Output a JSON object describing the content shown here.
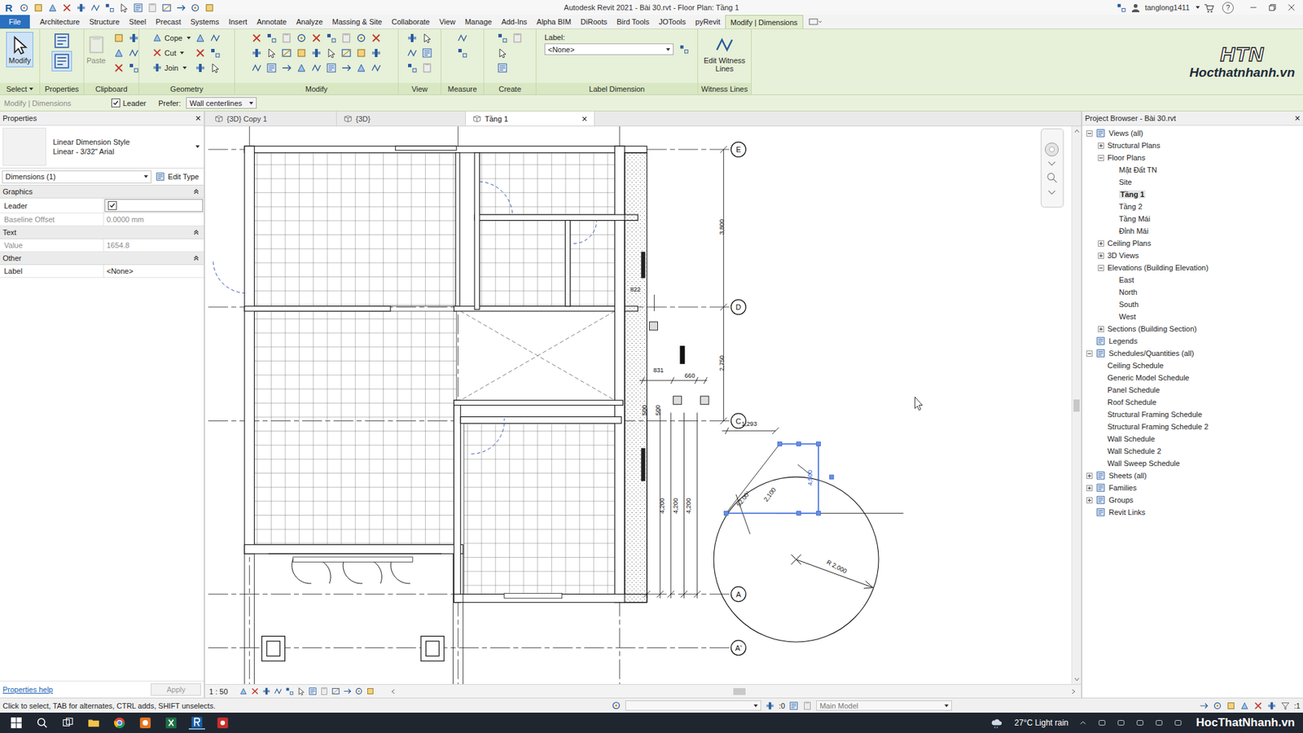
{
  "window": {
    "app_logo": "R",
    "title": "Autodesk Revit 2021 - Bài 30.rvt - Floor Plan: Tầng 1",
    "user": "tanglong1411",
    "help": "?"
  },
  "menu_tabs": [
    {
      "label": "File",
      "selected": false,
      "kind": "file"
    },
    {
      "label": "Architecture",
      "selected": false,
      "kind": "tab"
    },
    {
      "label": "Structure",
      "selected": false,
      "kind": "tab"
    },
    {
      "label": "Steel",
      "selected": false,
      "kind": "tab"
    },
    {
      "label": "Precast",
      "selected": false,
      "kind": "tab"
    },
    {
      "label": "Systems",
      "selected": false,
      "kind": "tab"
    },
    {
      "label": "Insert",
      "selected": false,
      "kind": "tab"
    },
    {
      "label": "Annotate",
      "selected": false,
      "kind": "tab"
    },
    {
      "label": "Analyze",
      "selected": false,
      "kind": "tab"
    },
    {
      "label": "Massing & Site",
      "selected": false,
      "kind": "tab"
    },
    {
      "label": "Collaborate",
      "selected": false,
      "kind": "tab"
    },
    {
      "label": "View",
      "selected": false,
      "kind": "tab"
    },
    {
      "label": "Manage",
      "selected": false,
      "kind": "tab"
    },
    {
      "label": "Add-Ins",
      "selected": false,
      "kind": "tab"
    },
    {
      "label": "Alpha BIM",
      "selected": false,
      "kind": "tab"
    },
    {
      "label": "DiRoots",
      "selected": false,
      "kind": "tab"
    },
    {
      "label": "Bird Tools",
      "selected": false,
      "kind": "tab"
    },
    {
      "label": "JOTools",
      "selected": false,
      "kind": "tab"
    },
    {
      "label": "pyRevit",
      "selected": false,
      "kind": "tab"
    },
    {
      "label": "Modify | Dimensions",
      "selected": true,
      "kind": "tab"
    }
  ],
  "ribbon": {
    "panels": [
      {
        "label": "Select",
        "dropdown": true,
        "large": [
          {
            "label": "Modify",
            "active": true,
            "disabled": false
          }
        ],
        "small": []
      },
      {
        "label": "Properties",
        "dropdown": false,
        "large": [],
        "small": []
      },
      {
        "label": "Clipboard",
        "dropdown": false,
        "large": [
          {
            "label": "Paste",
            "active": false,
            "disabled": true
          }
        ],
        "small": []
      },
      {
        "label": "Geometry",
        "dropdown": false,
        "large": [],
        "small": [
          {
            "label": "Cope"
          },
          {
            "label": "Cut"
          },
          {
            "label": "Join"
          }
        ]
      },
      {
        "label": "Modify",
        "dropdown": false,
        "large": [],
        "small": []
      },
      {
        "label": "View",
        "dropdown": false,
        "large": [],
        "small": []
      },
      {
        "label": "Measure",
        "dropdown": false,
        "large": [],
        "small": []
      },
      {
        "label": "Create",
        "dropdown": false,
        "large": [],
        "small": []
      },
      {
        "label": "Label Dimension",
        "dropdown": false,
        "large": [],
        "small": [],
        "field": {
          "caption": "Label:",
          "value": "<None>"
        }
      },
      {
        "label": "Witness Lines",
        "dropdown": false,
        "large": [
          {
            "label": "Edit Witness Lines",
            "active": false,
            "disabled": false
          }
        ],
        "small": []
      }
    ]
  },
  "logo": {
    "mark": "HTN",
    "site": "Hocthatnhanh.vn"
  },
  "options_bar": {
    "context": "Modify | Dimensions",
    "leader": {
      "label": "Leader",
      "checked": true
    },
    "prefer": {
      "label": "Prefer:",
      "value": "Wall centerlines"
    }
  },
  "properties": {
    "title": "Properties",
    "close": "×",
    "type_family": "Linear Dimension Style",
    "type_name": "Linear - 3/32\" Arial",
    "filter": "Dimensions (1)",
    "edit_type": "Edit Type",
    "groups": [
      {
        "name": "Graphics",
        "expanded": true,
        "rows": [
          {
            "label": "Leader",
            "kind": "checkbox",
            "checked": true,
            "value": "",
            "disabled": false
          },
          {
            "label": "Baseline Offset",
            "kind": "text",
            "checked": false,
            "value": "0.0000 mm",
            "disabled": true
          }
        ]
      },
      {
        "name": "Text",
        "expanded": true,
        "rows": [
          {
            "label": "Value",
            "kind": "text",
            "checked": false,
            "value": "1654.8",
            "disabled": true
          }
        ]
      },
      {
        "name": "Other",
        "expanded": true,
        "rows": [
          {
            "label": "Label",
            "kind": "text",
            "checked": false,
            "value": "<None>",
            "disabled": false
          }
        ]
      }
    ],
    "help": "Properties help",
    "apply": {
      "label": "Apply",
      "disabled": true
    }
  },
  "view_tabs": [
    {
      "label": "{3D} Copy 1",
      "selected": false,
      "closable": false
    },
    {
      "label": "{3D}",
      "selected": false,
      "closable": false
    },
    {
      "label": "Tầng 1",
      "selected": true,
      "closable": true
    }
  ],
  "view_close": "×",
  "drawing": {
    "grids": [
      {
        "label": "E"
      },
      {
        "label": "D"
      },
      {
        "label": "C"
      },
      {
        "label": "A"
      },
      {
        "label": "A'"
      }
    ],
    "dimensions": [
      {
        "text": "3,800",
        "selected": false
      },
      {
        "text": "2,750",
        "selected": false
      },
      {
        "text": "822",
        "selected": false
      },
      {
        "text": "831",
        "selected": false
      },
      {
        "text": "660",
        "selected": false
      },
      {
        "text": "500",
        "selected": false
      },
      {
        "text": "500",
        "selected": false
      },
      {
        "text": "4,200",
        "selected": false
      },
      {
        "text": "4,200",
        "selected": false
      },
      {
        "text": "4,200",
        "selected": false
      },
      {
        "text": "1,293",
        "selected": false
      },
      {
        "text": "2,100",
        "selected": false
      },
      {
        "text": "52.00°",
        "selected": false
      },
      {
        "text": "4,500",
        "selected": true
      }
    ],
    "radius_label": "R 2,000"
  },
  "view_bar": {
    "scale": "1 : 50"
  },
  "browser": {
    "title": "Project Browser - Bài 30.rvt",
    "close": "×",
    "items": [
      {
        "label": "Views (all)",
        "level": 0,
        "expandable": true,
        "expanded": true,
        "selected": false
      },
      {
        "label": "Structural Plans",
        "level": 1,
        "expandable": true,
        "expanded": false,
        "selected": false
      },
      {
        "label": "Floor Plans",
        "level": 1,
        "expandable": true,
        "expanded": true,
        "selected": false
      },
      {
        "label": "Mặt Đất TN",
        "level": 2,
        "expandable": false,
        "expanded": false,
        "selected": false
      },
      {
        "label": "Site",
        "level": 2,
        "expandable": false,
        "expanded": false,
        "selected": false
      },
      {
        "label": "Tầng 1",
        "level": 2,
        "expandable": false,
        "expanded": false,
        "selected": true
      },
      {
        "label": "Tầng 2",
        "level": 2,
        "expandable": false,
        "expanded": false,
        "selected": false
      },
      {
        "label": "Tầng Mái",
        "level": 2,
        "expandable": false,
        "expanded": false,
        "selected": false
      },
      {
        "label": "Đỉnh Mái",
        "level": 2,
        "expandable": false,
        "expanded": false,
        "selected": false
      },
      {
        "label": "Ceiling Plans",
        "level": 1,
        "expandable": true,
        "expanded": false,
        "selected": false
      },
      {
        "label": "3D Views",
        "level": 1,
        "expandable": true,
        "expanded": false,
        "selected": false
      },
      {
        "label": "Elevations (Building Elevation)",
        "level": 1,
        "expandable": true,
        "expanded": true,
        "selected": false
      },
      {
        "label": "East",
        "level": 2,
        "expandable": false,
        "expanded": false,
        "selected": false
      },
      {
        "label": "North",
        "level": 2,
        "expandable": false,
        "expanded": false,
        "selected": false
      },
      {
        "label": "South",
        "level": 2,
        "expandable": false,
        "expanded": false,
        "selected": false
      },
      {
        "label": "West",
        "level": 2,
        "expandable": false,
        "expanded": false,
        "selected": false
      },
      {
        "label": "Sections (Building Section)",
        "level": 1,
        "expandable": true,
        "expanded": false,
        "selected": false
      },
      {
        "label": "Legends",
        "level": 0,
        "expandable": false,
        "expanded": false,
        "selected": false
      },
      {
        "label": "Schedules/Quantities (all)",
        "level": 0,
        "expandable": true,
        "expanded": true,
        "selected": false
      },
      {
        "label": "Ceiling Schedule",
        "level": 1,
        "expandable": false,
        "expanded": false,
        "selected": false
      },
      {
        "label": "Generic Model Schedule",
        "level": 1,
        "expandable": false,
        "expanded": false,
        "selected": false
      },
      {
        "label": "Panel Schedule",
        "level": 1,
        "expandable": false,
        "expanded": false,
        "selected": false
      },
      {
        "label": "Roof Schedule",
        "level": 1,
        "expandable": false,
        "expanded": false,
        "selected": false
      },
      {
        "label": "Structural Framing Schedule",
        "level": 1,
        "expandable": false,
        "expanded": false,
        "selected": false
      },
      {
        "label": "Structural Framing Schedule 2",
        "level": 1,
        "expandable": false,
        "expanded": false,
        "selected": false
      },
      {
        "label": "Wall Schedule",
        "level": 1,
        "expandable": false,
        "expanded": false,
        "selected": false
      },
      {
        "label": "Wall Schedule 2",
        "level": 1,
        "expandable": false,
        "expanded": false,
        "selected": false
      },
      {
        "label": "Wall Sweep Schedule",
        "level": 1,
        "expandable": false,
        "expanded": false,
        "selected": false
      },
      {
        "label": "Sheets (all)",
        "level": 0,
        "expandable": true,
        "expanded": false,
        "selected": false
      },
      {
        "label": "Families",
        "level": 0,
        "expandable": true,
        "expanded": false,
        "selected": false
      },
      {
        "label": "Groups",
        "level": 0,
        "expandable": true,
        "expanded": false,
        "selected": false
      },
      {
        "label": "Revit Links",
        "level": 0,
        "expandable": false,
        "expanded": false,
        "selected": false
      }
    ]
  },
  "status_bar": {
    "message": "Click to select, TAB for alternates, CTRL adds, SHIFT unselects.",
    "worksets": ":0",
    "model": "Main Model",
    "filters": ":1"
  },
  "taskbar": {
    "weather": "27°C Light rain",
    "watermark": "HocThatNhanh.vn"
  }
}
